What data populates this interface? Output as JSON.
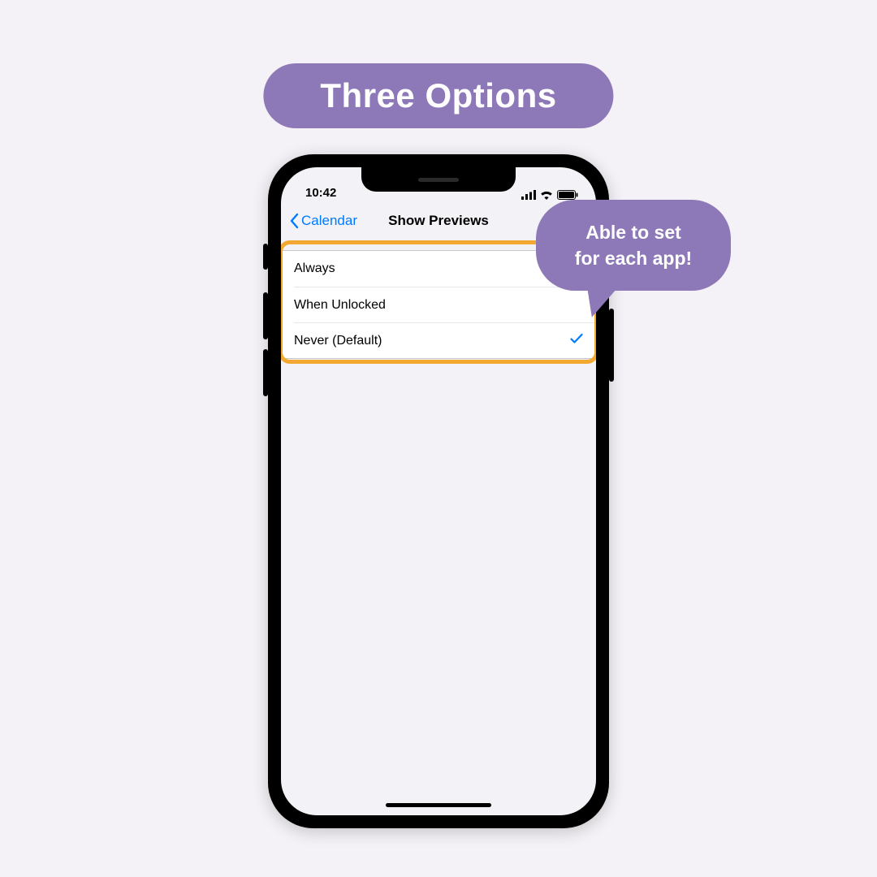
{
  "banner": {
    "title": "Three Options"
  },
  "bubble": {
    "line1": "Able to set",
    "line2": "for each app!"
  },
  "status": {
    "time": "10:42"
  },
  "nav": {
    "back": "Calendar",
    "title": "Show Previews"
  },
  "options": [
    {
      "label": "Always",
      "selected": false
    },
    {
      "label": "When Unlocked",
      "selected": false
    },
    {
      "label": "Never (Default)",
      "selected": true
    }
  ],
  "colors": {
    "accent": "#8d78b8",
    "highlight": "#f2a831",
    "link": "#007aff",
    "background": "#f4f2f6",
    "screen_bg": "#f2f2f7"
  }
}
